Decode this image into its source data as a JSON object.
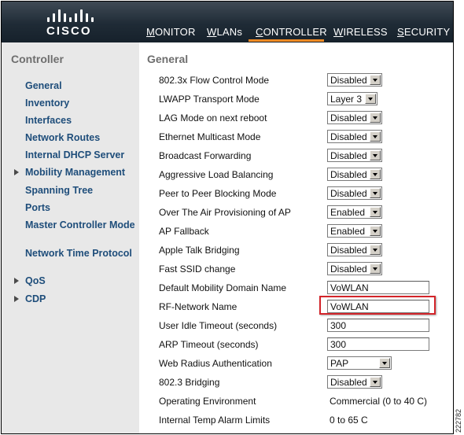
{
  "header": {
    "brand": "CISCO",
    "nav": [
      {
        "first": "M",
        "rest": "ONITOR"
      },
      {
        "first": "W",
        "rest": "LANs"
      },
      {
        "first": "C",
        "rest": "ONTROLLER"
      },
      {
        "first": "W",
        "rest": "IRELESS"
      },
      {
        "first": "S",
        "rest": "ECURITY"
      }
    ],
    "active_nav": "CONTROLLER",
    "accent_color": "#f08a24"
  },
  "sidebar": {
    "title": "Controller",
    "items": [
      {
        "label": "General",
        "expandable": false
      },
      {
        "label": "Inventory",
        "expandable": false
      },
      {
        "label": "Interfaces",
        "expandable": false
      },
      {
        "label": "Network Routes",
        "expandable": false
      },
      {
        "label": "Internal DHCP Server",
        "expandable": false
      },
      {
        "label": "Mobility Management",
        "expandable": true
      },
      {
        "label": "Spanning Tree",
        "expandable": false
      },
      {
        "label": "Ports",
        "expandable": false
      },
      {
        "label": "Master Controller Mode",
        "expandable": false
      },
      {
        "label": "Network Time Protocol",
        "expandable": false
      },
      {
        "label": "QoS",
        "expandable": true
      },
      {
        "label": "CDP",
        "expandable": true
      }
    ]
  },
  "main": {
    "title": "General",
    "rows": [
      {
        "label": "802.3x Flow Control Mode",
        "kind": "select",
        "value": "Disabled"
      },
      {
        "label": "LWAPP Transport Mode",
        "kind": "select",
        "value": "Layer 3"
      },
      {
        "label": "LAG Mode on next reboot",
        "kind": "select",
        "value": "Disabled"
      },
      {
        "label": "Ethernet Multicast Mode",
        "kind": "select",
        "value": "Disabled"
      },
      {
        "label": "Broadcast Forwarding",
        "kind": "select",
        "value": "Disabled"
      },
      {
        "label": "Aggressive Load Balancing",
        "kind": "select",
        "value": "Disabled"
      },
      {
        "label": "Peer to Peer Blocking Mode",
        "kind": "select",
        "value": "Disabled"
      },
      {
        "label": "Over The Air Provisioning of AP",
        "kind": "select",
        "value": "Enabled"
      },
      {
        "label": "AP Fallback",
        "kind": "select",
        "value": "Enabled"
      },
      {
        "label": "Apple Talk Bridging",
        "kind": "select",
        "value": "Disabled"
      },
      {
        "label": "Fast SSID change",
        "kind": "select",
        "value": "Disabled"
      },
      {
        "label": "Default Mobility Domain Name",
        "kind": "text",
        "value": "VoWLAN"
      },
      {
        "label": "RF-Network Name",
        "kind": "text",
        "value": "VoWLAN"
      },
      {
        "label": "User Idle Timeout (seconds)",
        "kind": "text",
        "value": "300"
      },
      {
        "label": "ARP Timeout (seconds)",
        "kind": "text",
        "value": "300"
      },
      {
        "label": "Web Radius Authentication",
        "kind": "select",
        "value": "PAP"
      },
      {
        "label": "802.3 Bridging",
        "kind": "select",
        "value": "Disabled"
      },
      {
        "label": "Operating Environment",
        "kind": "static",
        "value": "Commercial (0 to 40 C)"
      },
      {
        "label": "Internal Temp Alarm Limits",
        "kind": "static",
        "value": "0 to 65 C"
      }
    ],
    "highlight_color": "#d3242a"
  },
  "figure_number": "222782"
}
